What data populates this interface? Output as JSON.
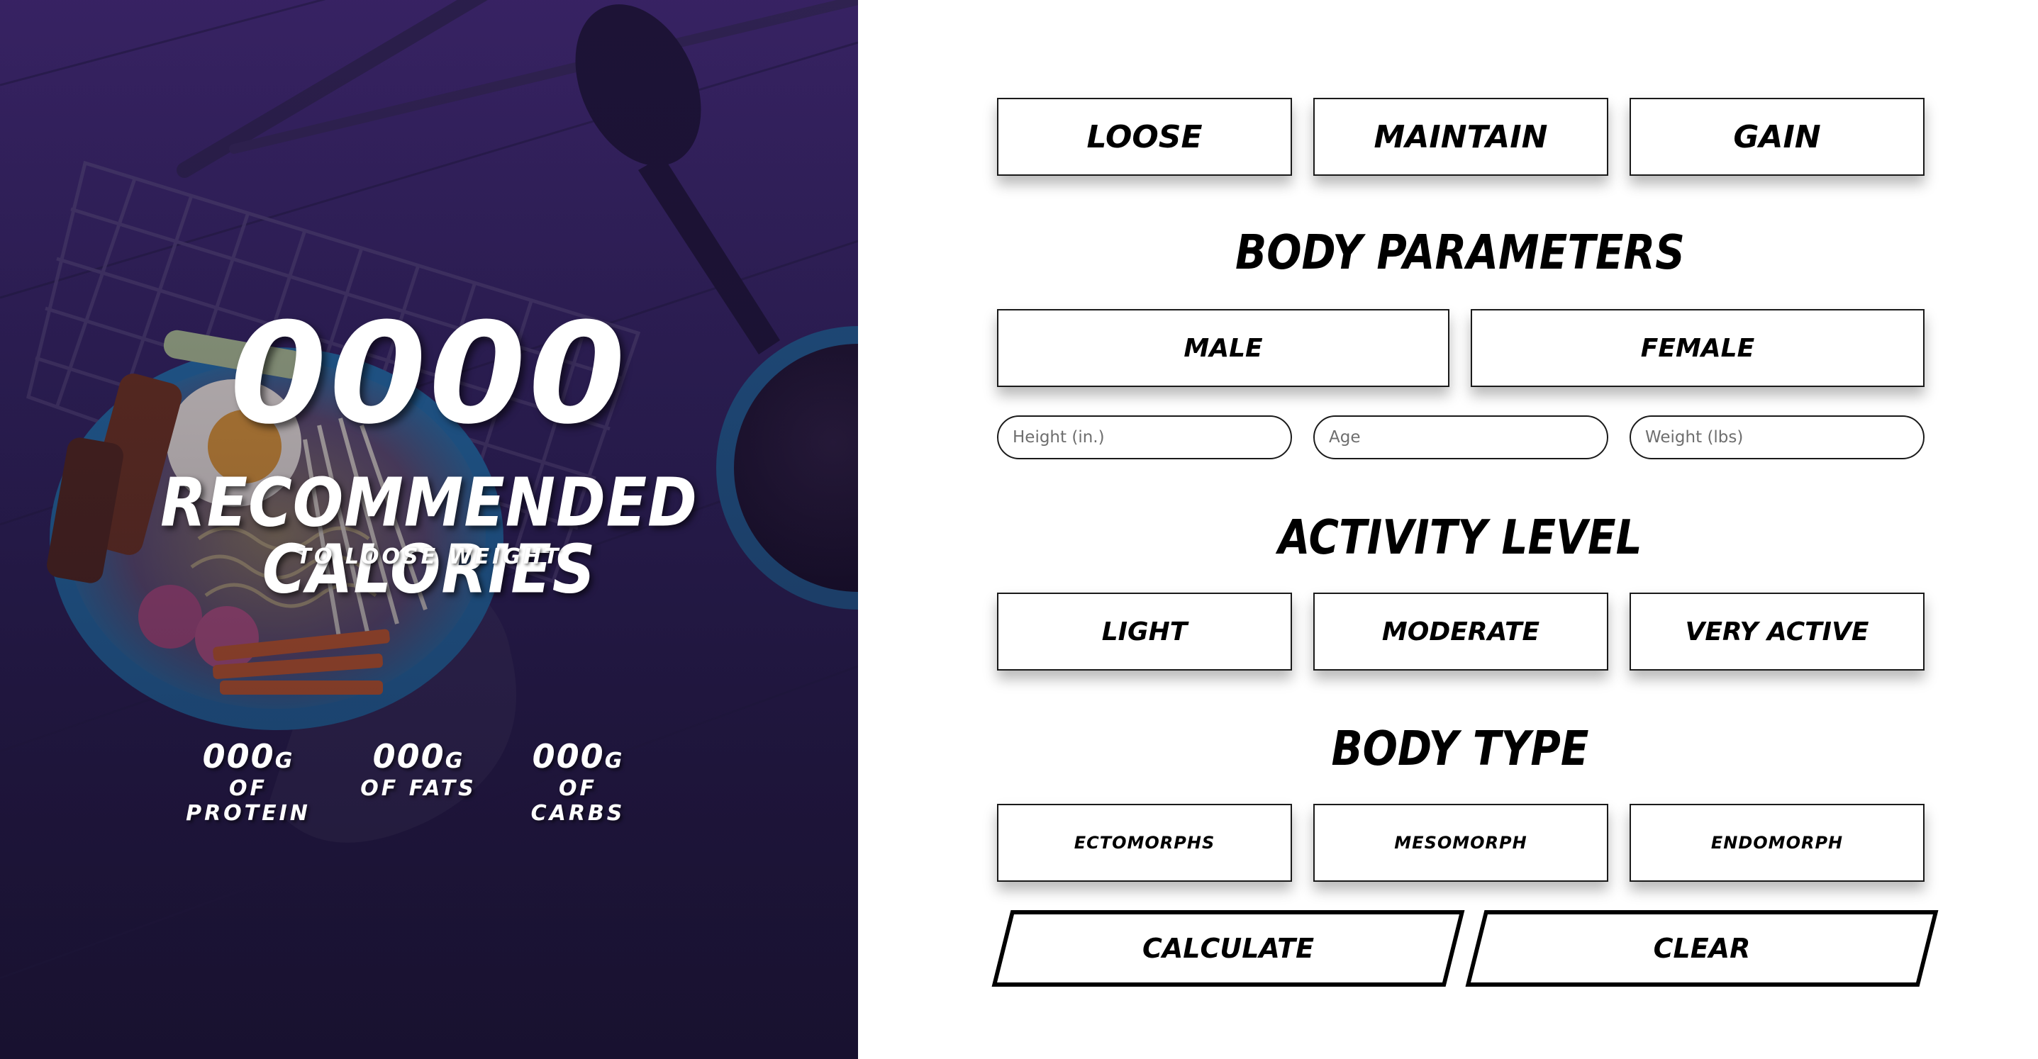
{
  "result": {
    "calories": "0000",
    "title": "RECOMMENDED CALORIES",
    "subtitle": "TO LOOSE WEIGHT",
    "macros": [
      {
        "amount": "000",
        "unit": "G",
        "label": "OF PROTEIN"
      },
      {
        "amount": "000",
        "unit": "G",
        "label": "OF FATS"
      },
      {
        "amount": "000",
        "unit": "G",
        "label": "OF CARBS"
      }
    ]
  },
  "goal": {
    "options": [
      "LOOSE",
      "MAINTAIN",
      "GAIN"
    ]
  },
  "body_parameters": {
    "title": "BODY PARAMETERS",
    "gender": [
      "MALE",
      "FEMALE"
    ],
    "fields": {
      "height_placeholder": "Height (in.)",
      "age_placeholder": "Age",
      "weight_placeholder": "Weight (lbs)"
    }
  },
  "activity": {
    "title": "ACTIVITY LEVEL",
    "options": [
      "LIGHT",
      "MODERATE",
      "VERY ACTIVE"
    ]
  },
  "body_type": {
    "title": "BODY TYPE",
    "options": [
      "ECTOMORPHS",
      "MESOMORPH",
      "ENDOMORPH"
    ]
  },
  "actions": {
    "calculate": "CALCULATE",
    "clear": "CLEAR"
  },
  "colors": {
    "hero_overlay": "#2c1f55",
    "text_light": "#ffffff",
    "border": "#000000"
  }
}
